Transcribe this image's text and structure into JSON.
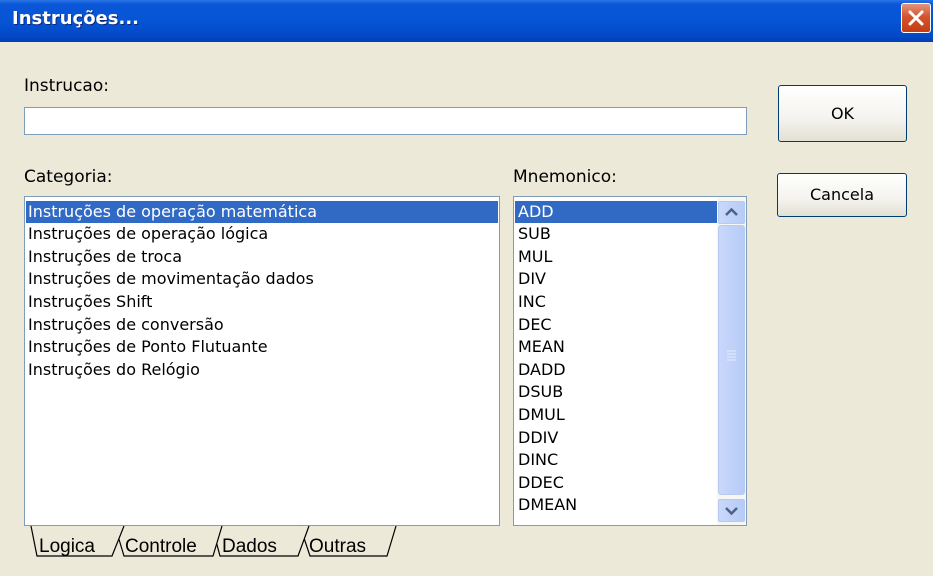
{
  "window": {
    "title": "Instruções..."
  },
  "instrucao": {
    "label": "Instrucao:",
    "value": ""
  },
  "buttons": {
    "ok": "OK",
    "cancel": "Cancela"
  },
  "categoria": {
    "label": "Categoria:",
    "items": [
      "Instruções de operação matemática",
      "Instruções de operação lógica",
      "Instruções de troca",
      "Instruções de movimentação dados",
      "Instruções Shift",
      "Instruções de conversão",
      "Instruções de Ponto Flutuante",
      "Instruções do Relógio"
    ]
  },
  "mnemonico": {
    "label": "Mnemonico:",
    "items": [
      "ADD",
      "SUB",
      "MUL",
      "DIV",
      "INC",
      "DEC",
      "MEAN",
      "DADD",
      "DSUB",
      "DMUL",
      "DDIV",
      "DINC",
      "DDEC",
      "DMEAN"
    ]
  },
  "tabs": [
    "Logica",
    "Controle",
    "Dados",
    "Outras"
  ],
  "icons": {
    "close": "close-icon",
    "scroll_up": "chevron-up-icon",
    "scroll_down": "chevron-down-icon",
    "grip": "grip-icon"
  },
  "colors": {
    "titlebar": "#0555d6",
    "selection": "#316ac5",
    "close": "#d4542e",
    "dialog": "#ece9d8"
  }
}
